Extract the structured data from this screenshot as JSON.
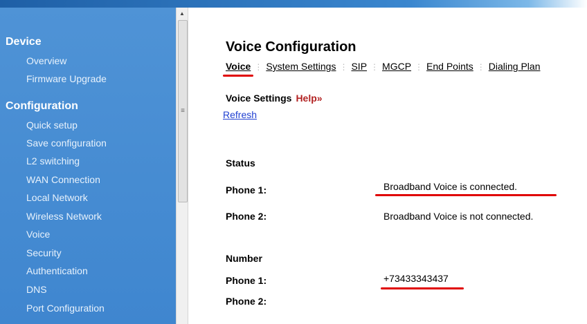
{
  "sidebar": {
    "device_title": "Device",
    "device_items": [
      "Overview",
      "Firmware Upgrade"
    ],
    "config_title": "Configuration",
    "config_items": [
      "Quick setup",
      "Save configuration",
      "L2 switching",
      "WAN Connection",
      "Local Network",
      "Wireless Network",
      "Voice",
      "Security",
      "Authentication",
      "DNS",
      "Port Configuration"
    ]
  },
  "main": {
    "title": "Voice Configuration",
    "tabs": [
      "Voice",
      "System Settings",
      "SIP",
      "MGCP",
      "End Points",
      "Dialing Plan"
    ],
    "heading": "Voice Settings",
    "help": "Help",
    "help_arrow": "»",
    "refresh": "Refresh",
    "status": {
      "title": "Status",
      "phone1_label": "Phone 1:",
      "phone1_value": "Broadband Voice is connected.",
      "phone2_label": "Phone 2:",
      "phone2_value": "Broadband Voice is not connected."
    },
    "number": {
      "title": "Number",
      "phone1_label": "Phone 1:",
      "phone1_value": "+73433343437",
      "phone2_label": "Phone 2:",
      "phone2_value": ""
    }
  },
  "colors": {
    "sidebar": "#4a8fd4",
    "annotation": "#e00000",
    "help": "#b22222",
    "link": "#1f3fd1"
  }
}
